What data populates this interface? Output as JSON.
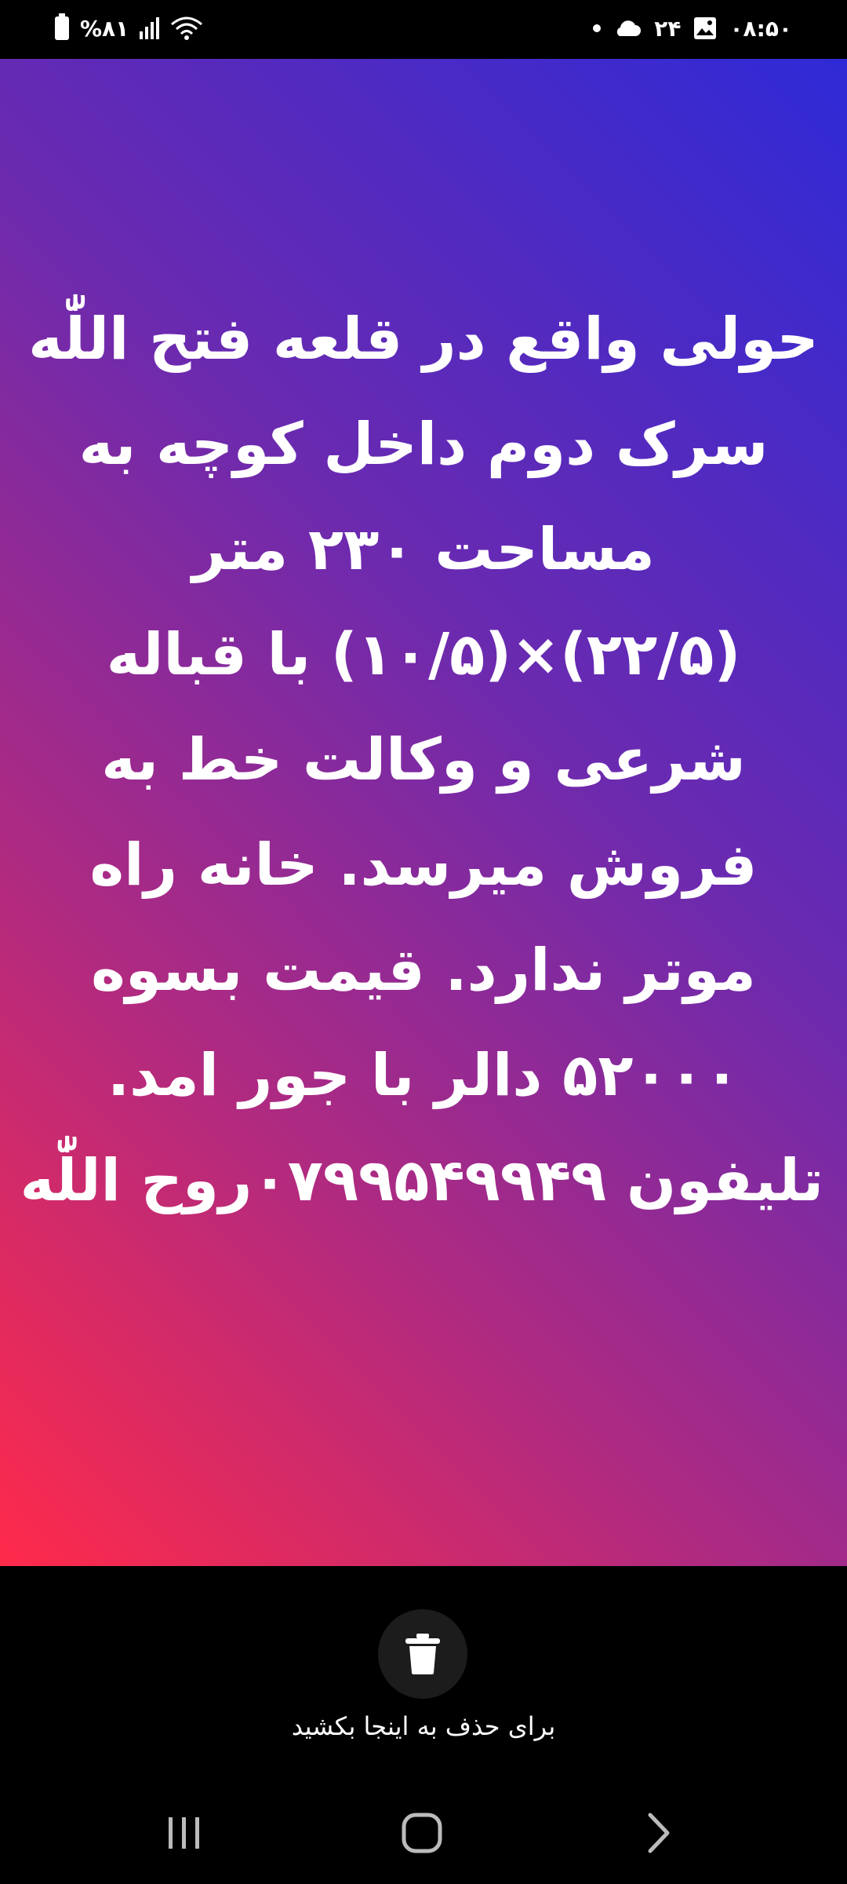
{
  "status_bar": {
    "time": "۰۸:۵۰",
    "temperature": "۲۴",
    "battery": "%۸۱",
    "icons": [
      "gallery-icon",
      "cloud-icon",
      "dot-icon",
      "wifi-icon",
      "signal-icon",
      "battery-icon"
    ]
  },
  "story": {
    "lines": [
      "حولی واقع در قلعه فتح اللّٰه",
      "سرک دوم داخل کوچه به",
      "مساحت ۲۳۰ متر",
      "(۲۲/۵)×(۱۰/۵) با قباله",
      "شرعی و وکالت خط به",
      "فروش میرسد. خانه راه",
      "موتر ندارد. قیمت بسوه",
      "۵۲۰۰۰ دالر با جور امد.",
      "تلیفون ۰۷۹۹۵۴۹۹۴۹روح اللّٰه"
    ],
    "gradient": [
      "#2f2ad6",
      "#ff2a4a"
    ]
  },
  "trash": {
    "hint": "برای حذف به اینجا بکشید",
    "icon": "trash-icon"
  },
  "nav": {
    "icons": [
      "recents-icon",
      "home-icon",
      "back-icon"
    ]
  }
}
